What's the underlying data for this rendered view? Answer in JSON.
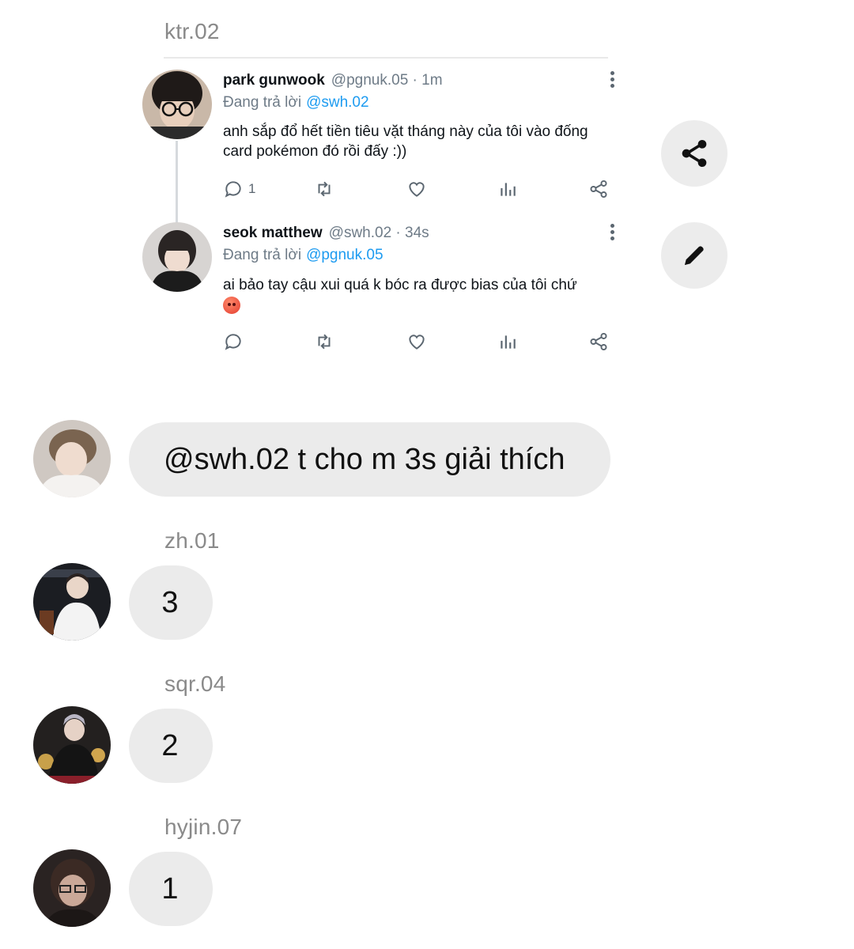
{
  "chat": {
    "messages": [
      {
        "sender": "ktr.02"
      },
      {
        "sender": "",
        "text": "@swh.02 t cho m 3s giải thích"
      },
      {
        "sender": "zh.01",
        "text": "3"
      },
      {
        "sender": "sqr.04",
        "text": "2"
      },
      {
        "sender": "hyjin.07",
        "text": "1"
      }
    ]
  },
  "tweets": [
    {
      "name": "park gunwook",
      "handle_time": "@pgnuk.05 · 1m",
      "replying_label": "Đang trả lời",
      "replying_to": "@swh.02",
      "text": "anh sắp đổ hết tiền tiêu vặt tháng này của tôi vào đống card pokémon đó rồi đấy :))",
      "reply_count": "1"
    },
    {
      "name": "seok matthew",
      "handle_time": "@swh.02 · 34s",
      "replying_label": "Đang trả lời",
      "replying_to": "@pgnuk.05",
      "text": "ai bảo tay cậu xui quá k bóc ra được bias của tôi chứ",
      "reply_count": ""
    }
  ],
  "icons": {
    "reply": "comment-icon",
    "retweet": "retweet-icon",
    "like": "heart-icon",
    "views": "bar-chart-icon",
    "share": "share-icon",
    "more": "more-vertical-icon",
    "fab_share": "share-icon",
    "fab_edit": "pencil-icon"
  },
  "colors": {
    "mention": "#1d9bf0",
    "bubble": "#ebebeb",
    "sender": "#8a8a8a"
  }
}
